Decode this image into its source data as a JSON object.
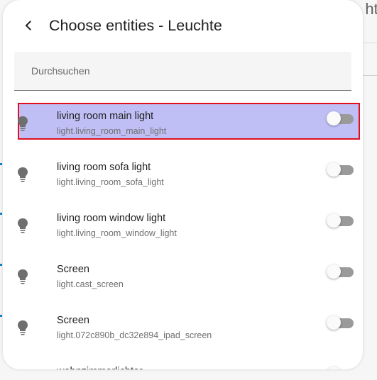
{
  "background": {
    "header_fragment": "htu"
  },
  "dialog": {
    "title": "Choose entities - Leuchte",
    "back_icon": "chevron-left-icon",
    "search": {
      "placeholder": "Durchsuchen",
      "value": ""
    },
    "entities": [
      {
        "name": "living room main light",
        "entity_id": "light.living_room_main_light",
        "icon": "lightbulb-icon",
        "enabled": false,
        "highlighted": true
      },
      {
        "name": "living room sofa light",
        "entity_id": "light.living_room_sofa_light",
        "icon": "lightbulb-icon",
        "enabled": false,
        "highlighted": false
      },
      {
        "name": "living room window light",
        "entity_id": "light.living_room_window_light",
        "icon": "lightbulb-icon",
        "enabled": false,
        "highlighted": false
      },
      {
        "name": "Screen",
        "entity_id": "light.cast_screen",
        "icon": "lightbulb-icon",
        "enabled": false,
        "highlighted": false
      },
      {
        "name": "Screen",
        "entity_id": "light.072c890b_dc32e894_ipad_screen",
        "icon": "lightbulb-icon",
        "enabled": false,
        "highlighted": false
      },
      {
        "name": "wohnzimmerlichter",
        "entity_id": "",
        "icon": "lightbulb-icon",
        "enabled": false,
        "highlighted": false
      }
    ]
  },
  "colors": {
    "highlight_fill": "#bfbff6",
    "highlight_border": "#e01020",
    "icon_color": "#6f6f6f",
    "toggle_track": "#9a9a9a"
  }
}
